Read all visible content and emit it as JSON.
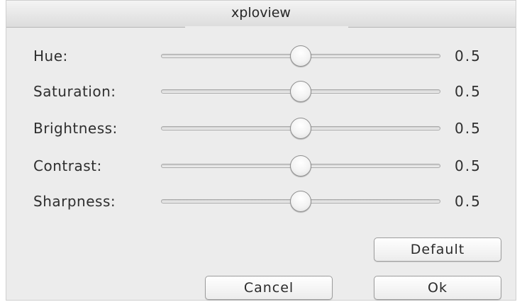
{
  "window": {
    "title": "xploview"
  },
  "sliders": [
    {
      "label": "Hue:",
      "value": "0.5",
      "level": 0.5
    },
    {
      "label": "Saturation:",
      "value": "0.5",
      "level": 0.5
    },
    {
      "label": "Brightness:",
      "value": "0.5",
      "level": 0.5
    },
    {
      "label": "Contrast:",
      "value": "0.5",
      "level": 0.5
    },
    {
      "label": "Sharpness:",
      "value": "0.5",
      "level": 0.5
    }
  ],
  "buttons": {
    "default_label": "Default",
    "cancel_label": "Cancel",
    "ok_label": "Ok"
  }
}
